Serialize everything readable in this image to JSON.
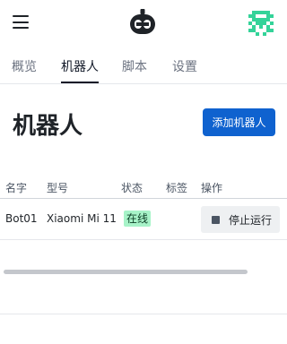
{
  "header": {
    "menu_icon": "hamburger-menu-icon",
    "logo_icon": "robot-logo-icon",
    "avatar_icon": "pixel-avatar-icon"
  },
  "tabs": [
    {
      "label": "概览",
      "active": false
    },
    {
      "label": "机器人",
      "active": true
    },
    {
      "label": "脚本",
      "active": false
    },
    {
      "label": "设置",
      "active": false
    }
  ],
  "main": {
    "title": "机器人",
    "add_button_label": "添加机器人"
  },
  "table": {
    "columns": [
      "名字",
      "型号",
      "状态",
      "标签",
      "操作"
    ],
    "rows": [
      {
        "name": "Bot01",
        "model": "Xiaomi Mi 11",
        "status": "在线",
        "tags": "",
        "action_label": "停止运行"
      }
    ]
  },
  "colors": {
    "accent": "#0f62cf",
    "status_online_bg": "#a7f3c8",
    "avatar_green": "#34d399"
  }
}
